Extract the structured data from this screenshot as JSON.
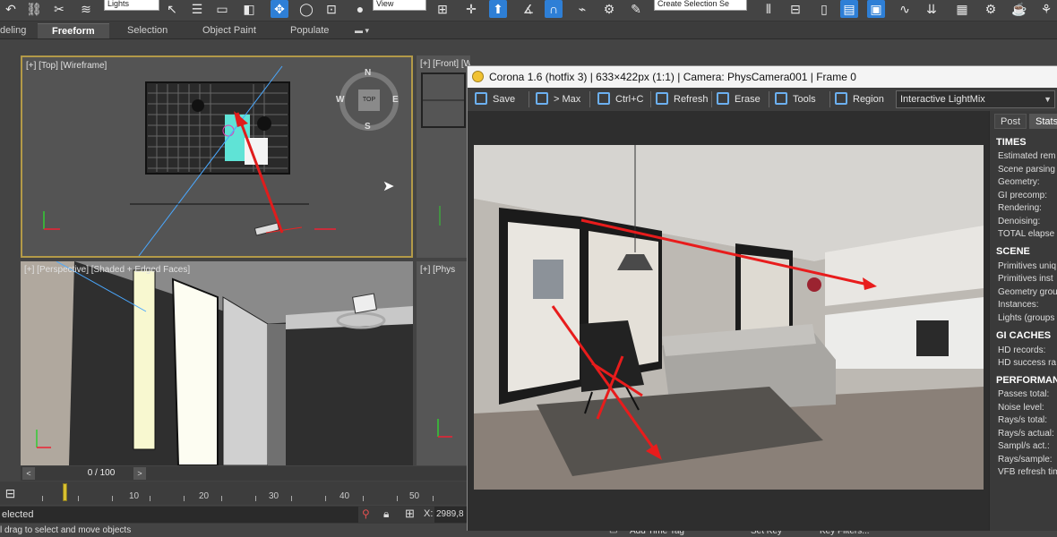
{
  "toolbar": {
    "selection_filter": "Lights",
    "reference_coord": "View",
    "named_selection": "Create Selection Se"
  },
  "ribbon": {
    "tabs": [
      "deling",
      "Freeform",
      "Selection",
      "Object Paint",
      "Populate"
    ]
  },
  "viewports": {
    "top_label": "[+] [Top] [Wireframe]",
    "front_label": "[+] [Front] [Wireframe]",
    "perspective_label": "[+] [Perspective] [Shaded + Edged Faces]",
    "phys_label": "[+] [Phys"
  },
  "viewcube": {
    "face": "TOP",
    "north": "N",
    "south": "S",
    "east": "E",
    "west": "W"
  },
  "timeslider": {
    "frame": "0 / 100",
    "prev": "<",
    "next": ">"
  },
  "trackbar": {
    "ticks": [
      "10",
      "20",
      "30",
      "40",
      "50"
    ]
  },
  "status": {
    "selection": "elected",
    "coord_x_label": "X:",
    "coord_x_value": "2989,8",
    "prompt": "l drag to select and move objects",
    "add_time_tag": "Add Time Tag",
    "set_key": "Set Key",
    "key_filters": "Key Filters..."
  },
  "vfb": {
    "title": "Corona 1.6 (hotfix 3) | 633×422px (1:1) | Camera: PhysCamera001 | Frame 0",
    "buttons": {
      "save": "Save",
      "max": "> Max",
      "copy": "Ctrl+C",
      "refresh": "Refresh",
      "erase": "Erase",
      "tools": "Tools",
      "region": "Region"
    },
    "mode": "Interactive LightMix",
    "side_tabs": [
      "Post",
      "Stats"
    ],
    "stats": {
      "times_head": "TIMES",
      "times": [
        "Estimated rem",
        "Scene parsing",
        "Geometry:",
        "GI precomp:",
        "Rendering:",
        "Denoising:",
        "TOTAL elapse"
      ],
      "scene_head": "SCENE",
      "scene": [
        "Primitives uniq",
        "Primitives inst",
        "Geometry grou",
        "Instances:",
        "Lights (groups"
      ],
      "gi_head": "GI CACHES",
      "gi": [
        "HD records:",
        "HD success ra"
      ],
      "perf_head": "PERFORMANC",
      "perf": [
        "Passes total:",
        "Noise level:",
        "Rays/s total:",
        "Rays/s actual:",
        "Sampl/s act.:",
        "Rays/sample:",
        "VFB refresh tim"
      ]
    }
  },
  "colors": {
    "accent": "#2e7fd6",
    "annotation": "#e41d1d",
    "viewport_active_border": "#b39a48"
  }
}
